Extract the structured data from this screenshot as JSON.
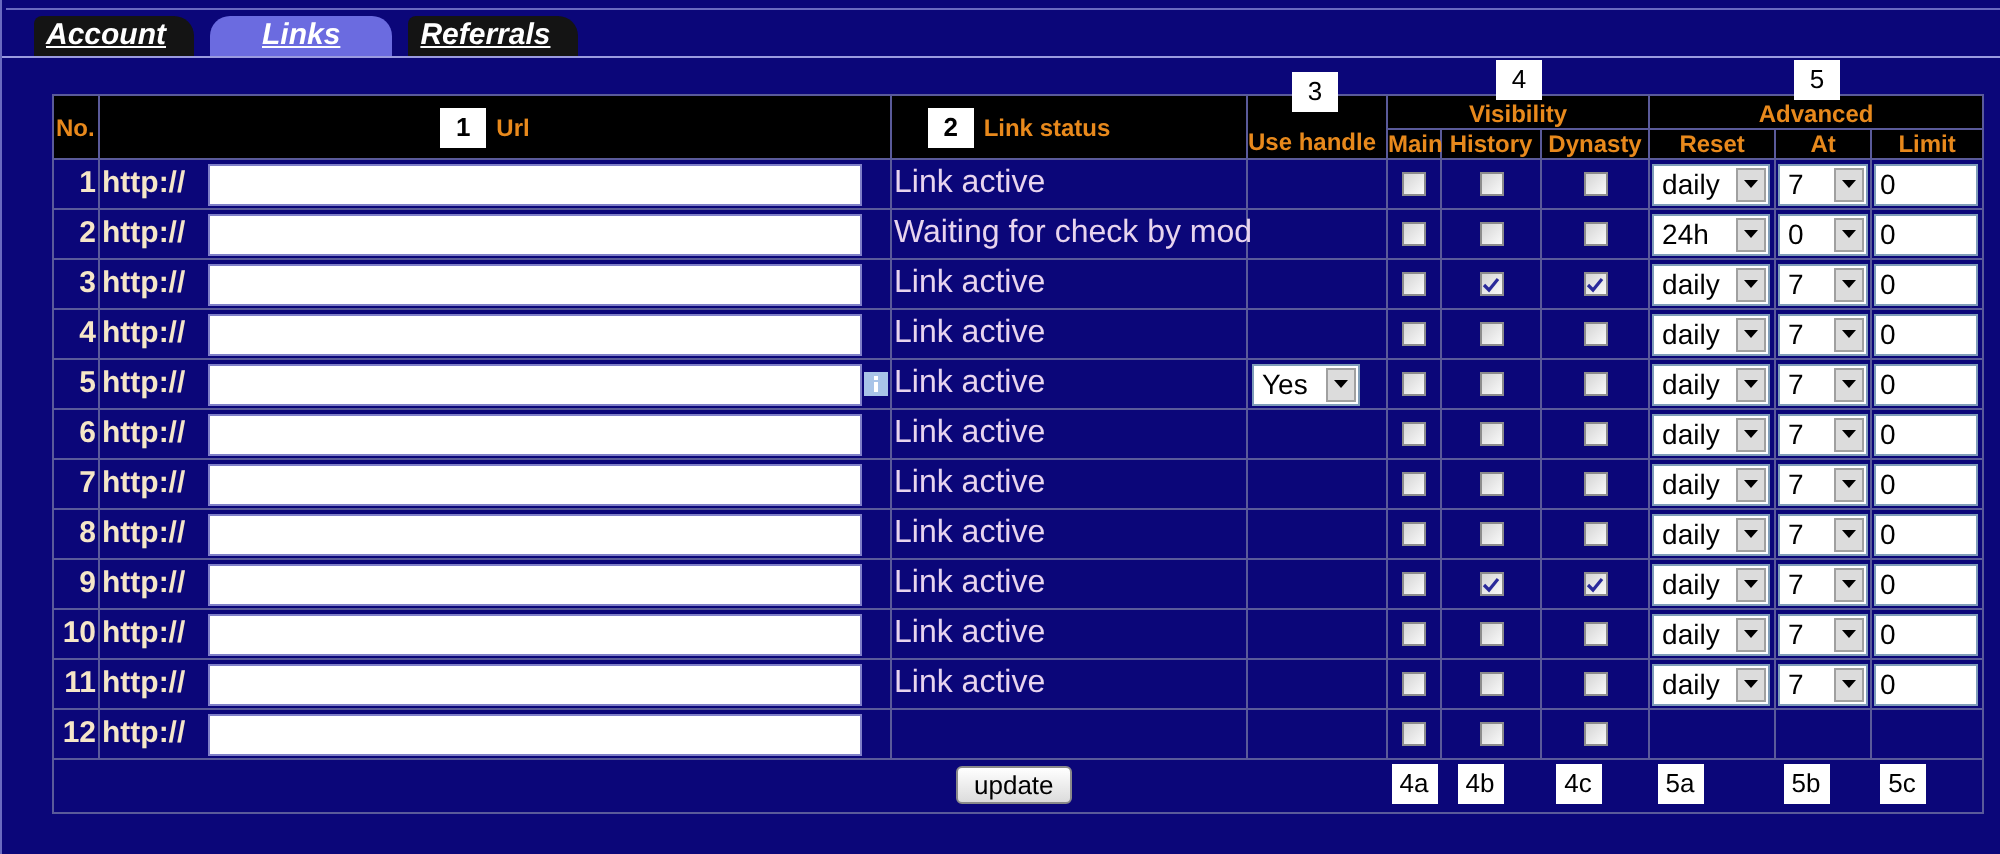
{
  "tabs": [
    {
      "label": "Account",
      "selected": false
    },
    {
      "label": "Links",
      "selected": true
    },
    {
      "label": "Referrals",
      "selected": false
    }
  ],
  "table": {
    "headers": {
      "no": "No.",
      "url": "Url",
      "status": "Link status",
      "handle": "Use handle",
      "visibility": "Visibility",
      "main": "Main",
      "history": "History",
      "dynasty": "Dynasty",
      "advanced": "Advanced",
      "reset": "Reset",
      "at": "At",
      "limit": "Limit"
    },
    "badges": {
      "url": "1",
      "status": "2",
      "handle": "3",
      "visibility": "4",
      "advanced": "5"
    },
    "rows": [
      {
        "no": "1",
        "prefix": "http://",
        "info": false,
        "status": "Link active",
        "main": false,
        "history": false,
        "dynasty": false,
        "reset": "daily",
        "at": "7",
        "limit": "0"
      },
      {
        "no": "2",
        "prefix": "http://",
        "info": false,
        "status": "Waiting for check by mod",
        "main": false,
        "history": false,
        "dynasty": false,
        "reset": "24h",
        "at": "0",
        "limit": "0"
      },
      {
        "no": "3",
        "prefix": "http://",
        "info": false,
        "status": "Link active",
        "main": false,
        "history": true,
        "dynasty": true,
        "reset": "daily",
        "at": "7",
        "limit": "0"
      },
      {
        "no": "4",
        "prefix": "http://",
        "info": false,
        "status": "Link active",
        "main": false,
        "history": false,
        "dynasty": false,
        "reset": "daily",
        "at": "7",
        "limit": "0"
      },
      {
        "no": "5",
        "prefix": "http://",
        "info": true,
        "status": "Link active",
        "handle": "Yes",
        "main": false,
        "history": false,
        "dynasty": false,
        "reset": "daily",
        "at": "7",
        "limit": "0"
      },
      {
        "no": "6",
        "prefix": "http://",
        "info": false,
        "status": "Link active",
        "main": false,
        "history": false,
        "dynasty": false,
        "reset": "daily",
        "at": "7",
        "limit": "0"
      },
      {
        "no": "7",
        "prefix": "http://",
        "info": false,
        "status": "Link active",
        "main": false,
        "history": false,
        "dynasty": false,
        "reset": "daily",
        "at": "7",
        "limit": "0"
      },
      {
        "no": "8",
        "prefix": "http://",
        "info": false,
        "status": "Link active",
        "main": false,
        "history": false,
        "dynasty": false,
        "reset": "daily",
        "at": "7",
        "limit": "0"
      },
      {
        "no": "9",
        "prefix": "http://",
        "info": false,
        "status": "Link active",
        "main": false,
        "history": true,
        "dynasty": true,
        "reset": "daily",
        "at": "7",
        "limit": "0"
      },
      {
        "no": "10",
        "prefix": "http://",
        "info": false,
        "status": "Link active",
        "main": false,
        "history": false,
        "dynasty": false,
        "reset": "daily",
        "at": "7",
        "limit": "0"
      },
      {
        "no": "11",
        "prefix": "http://",
        "info": false,
        "status": "Link active",
        "main": false,
        "history": false,
        "dynasty": false,
        "reset": "daily",
        "at": "7",
        "limit": "0"
      },
      {
        "no": "12",
        "prefix": "http://",
        "info": false,
        "main": false,
        "history": false,
        "dynasty": false
      }
    ],
    "footer": {
      "button": "update",
      "badges": [
        "4a",
        "4b",
        "4c",
        "5a",
        "5b",
        "5c"
      ]
    }
  }
}
